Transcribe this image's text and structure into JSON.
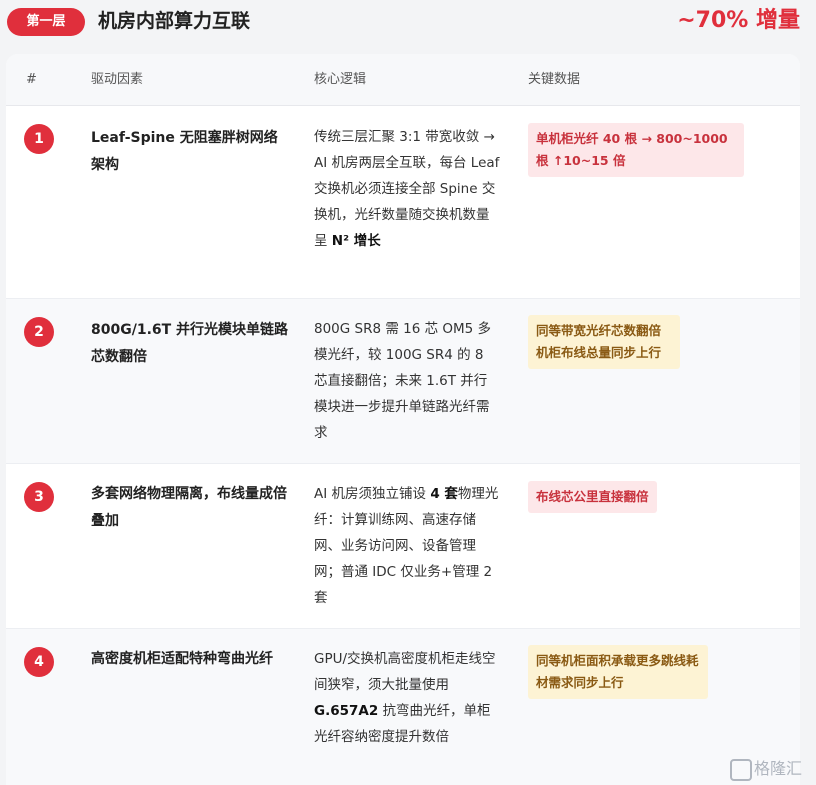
{
  "header": {
    "badge": "第一层",
    "title": "机房内部算力互联",
    "stat": "~70% 增量"
  },
  "table": {
    "columns": [
      "#",
      "驱动因素",
      "核心逻辑",
      "关键数据"
    ],
    "rows": [
      {
        "num": "1",
        "factor": "Leaf-Spine 无阻塞胖树网络架构",
        "logic_a": "传统三层汇聚 3:1 带宽收敛 → AI 机房两层全互联，每台 Leaf 交换机必须连接全部 Spine 交换机，光纤数量随交换机数量呈 ",
        "logic_b": "N² 增长",
        "logic_c": "",
        "tag": "单机柜光纤 40 根 → 800~1000 根 ↑10~15 倍",
        "tag_color": "#fde7e9"
      },
      {
        "num": "2",
        "factor": "800G/1.6T 并行光模块单链路芯数翻倍",
        "logic_a": "800G SR8 需 16 芯 OM5 多模光纤，较 100G SR4 的 8 芯直接翻倍；未来 1.6T 并行模块进一步提升单链路光纤需求",
        "logic_b": "",
        "logic_c": "",
        "tag": "同等带宽光纤芯数翻倍 机柜布线总量同步上行",
        "tag_color": "#fdf3d4"
      },
      {
        "num": "3",
        "factor": "多套网络物理隔离，布线量成倍叠加",
        "logic_a": "AI 机房须独立铺设 ",
        "logic_b": "4 套",
        "logic_c": "物理光纤：计算训练网、高速存储网、业务访问网、设备管理网；普通 IDC 仅业务+管理 2 套",
        "tag": "布线芯公里直接翻倍",
        "tag_color": "#fde7e9"
      },
      {
        "num": "4",
        "factor": "高密度机柜适配特种弯曲光纤",
        "logic_a": "GPU/交换机高密度机柜走线空间狭窄，须大批量使用 ",
        "logic_b": "G.657A2",
        "logic_c": " 抗弯曲光纤，单柜光纤容纳密度提升数倍",
        "tag": "同等机柜面积承载更多跳线耗材需求同步上行",
        "tag_color": "#fdf3d4"
      }
    ]
  },
  "watermark": "格隆汇"
}
